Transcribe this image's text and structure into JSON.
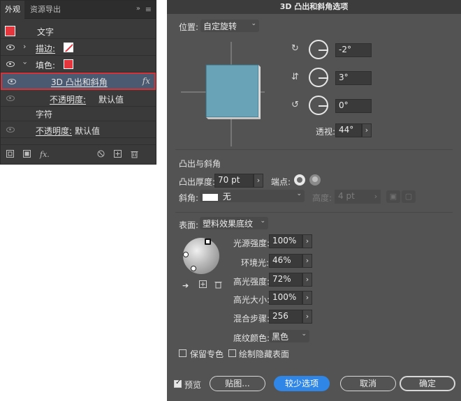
{
  "appearance": {
    "tabs": [
      "外观",
      "资源导出"
    ],
    "collapse_glyph": "»",
    "menu_glyph": "≡",
    "rows": {
      "object_label": "文字",
      "stroke_label": "描边:",
      "fill_label": "填色:",
      "effect_label": "3D 凸出和斜角",
      "effect_fx": "fx",
      "fill_opacity_label": "不透明度:",
      "fill_opacity_value": "默认值",
      "char_label": "字符",
      "opacity_label": "不透明度:",
      "opacity_value": "默认值"
    },
    "fx_glyph": "fx."
  },
  "dialog": {
    "title": "3D 凸出和斜角选项",
    "position_label": "位置:",
    "position_value": "自定旋转",
    "rotation": {
      "x": "-2°",
      "y": "3°",
      "z": "0°"
    },
    "perspective_label": "透视:",
    "perspective_value": "44°",
    "extrude_section": "凸出与斜角",
    "extrude_depth_label": "凸出厚度:",
    "extrude_depth_value": "70 pt",
    "cap_label": "端点:",
    "bevel_label": "斜角:",
    "bevel_value": "无",
    "height_label": "高度:",
    "height_value": "4 pt",
    "surface_label": "表面:",
    "surface_value": "塑料效果底纹",
    "light_intensity_label": "光源强度:",
    "light_intensity_value": "100%",
    "ambient_label": "环境光:",
    "ambient_value": "46%",
    "highlight_intensity_label": "高光强度:",
    "highlight_intensity_value": "72%",
    "highlight_size_label": "高光大小:",
    "highlight_size_value": "100%",
    "blend_steps_label": "混合步骤:",
    "blend_steps_value": "256",
    "shading_color_label": "底纹颜色:",
    "shading_color_value": "黑色",
    "preserve_spot_label": "保留专色",
    "draw_hidden_label": "绘制隐藏表面",
    "preview_label": "预览",
    "map_button": "贴图...",
    "fewer_options_button": "较少选项",
    "cancel_button": "取消",
    "ok_button": "确定"
  },
  "colors": {
    "accent_red": "#e5363d",
    "cube_face": "#69a3b8",
    "primary_button": "#2f86e6"
  }
}
